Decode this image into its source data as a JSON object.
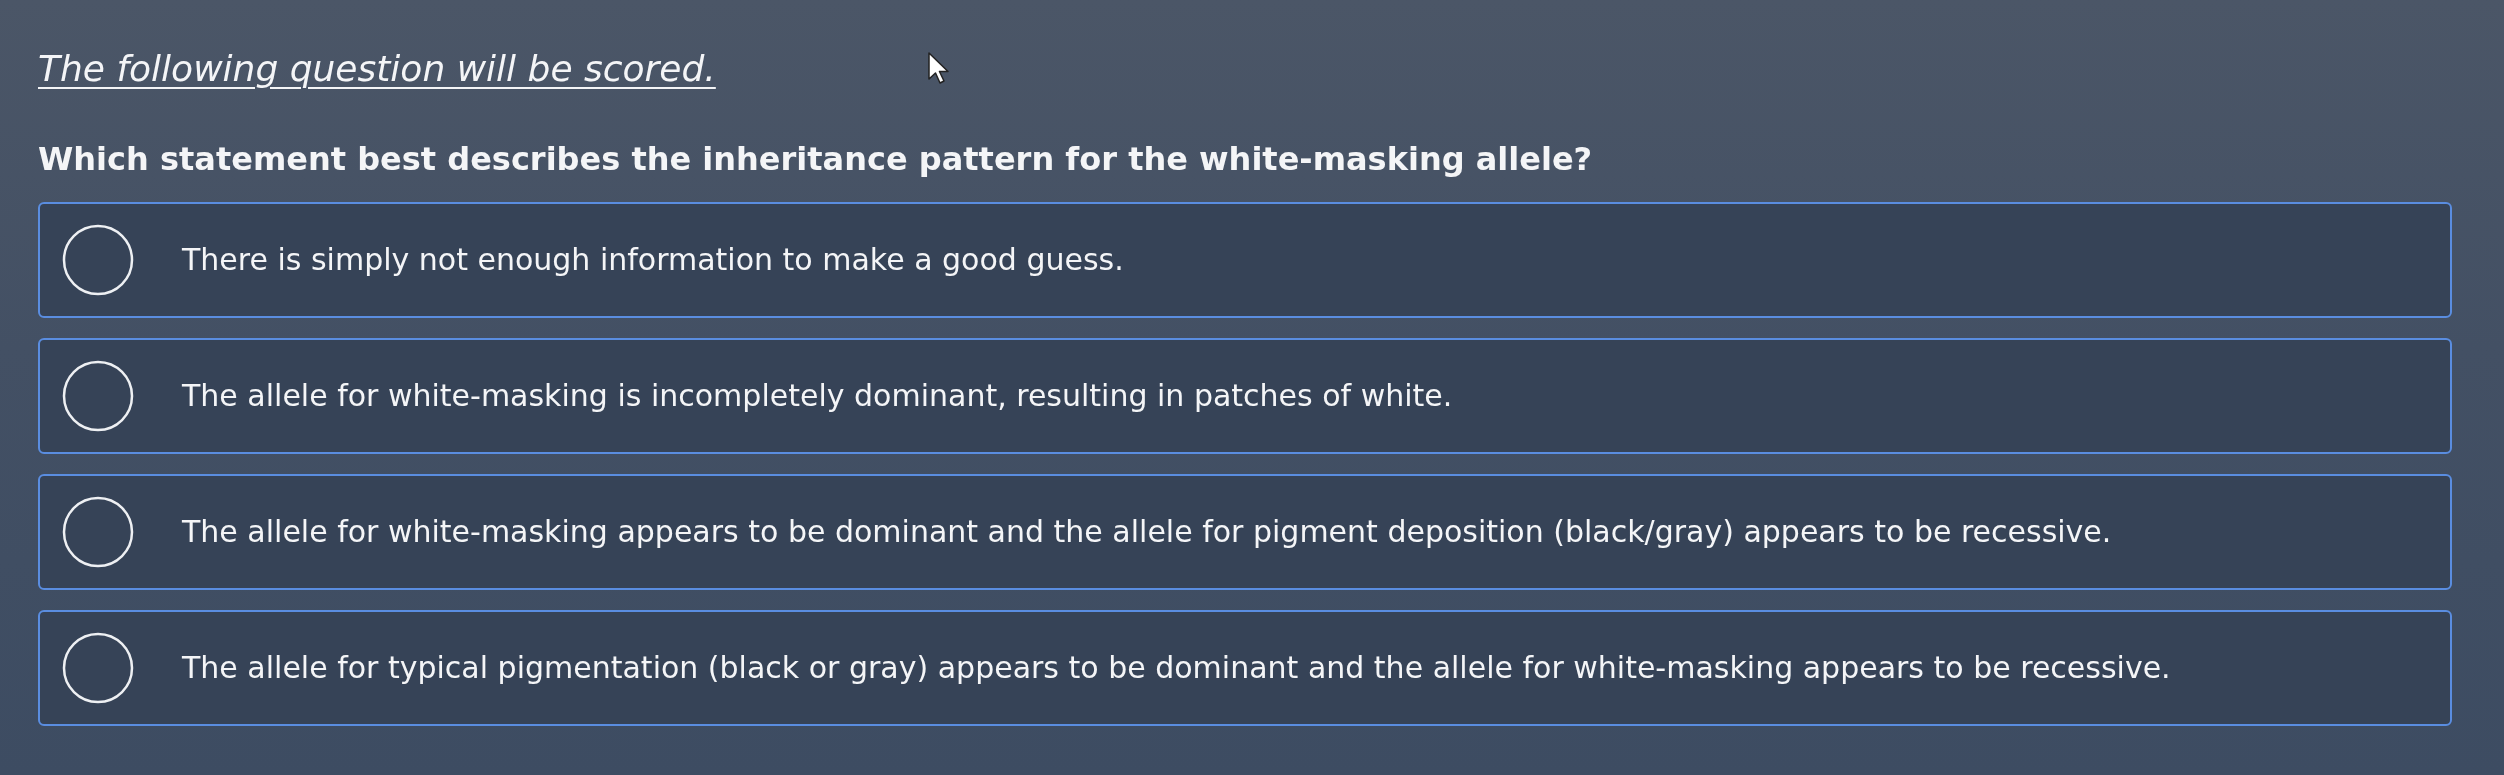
{
  "notice": "The following question will be scored.",
  "question": {
    "text": "Which statement best describes the inheritance pattern for the white-masking allele?",
    "options": [
      {
        "label": "There is simply not enough information to make a good guess.",
        "selected": false
      },
      {
        "label": "The allele for white-masking is incompletely dominant, resulting in patches of white.",
        "selected": false
      },
      {
        "label": "The allele for white-masking appears to be dominant and the allele for pigment deposition (black/gray) appears to be recessive.",
        "selected": false
      },
      {
        "label": "The allele for typical pigmentation (black or gray) appears to be dominant and the allele for white-masking appears to be recessive.",
        "selected": false
      }
    ]
  }
}
